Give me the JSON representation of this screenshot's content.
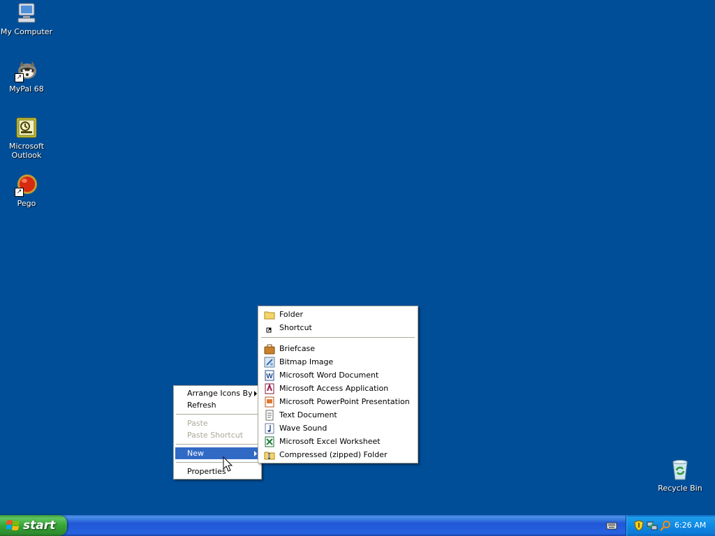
{
  "desktop": {
    "background": "#004e98",
    "icons": [
      {
        "label": "My Computer",
        "icon": "computer-icon"
      },
      {
        "label": "MyPal 68",
        "icon": "raccoon-icon"
      },
      {
        "label": "Microsoft Outlook",
        "icon": "outlook-icon"
      },
      {
        "label": "Pego",
        "icon": "pego-icon"
      },
      {
        "label": "Recycle Bin",
        "icon": "recycle-bin-icon"
      }
    ]
  },
  "context_menu": {
    "items": [
      {
        "label": "Arrange Icons By",
        "submenu": true,
        "enabled": true
      },
      {
        "label": "Refresh",
        "enabled": true
      },
      {
        "label": "Paste",
        "enabled": false
      },
      {
        "label": "Paste Shortcut",
        "enabled": false
      },
      {
        "label": "New",
        "submenu": true,
        "enabled": true,
        "selected": true
      },
      {
        "label": "Properties",
        "enabled": true
      }
    ],
    "highlight_color": "#316ac5"
  },
  "new_submenu": {
    "items": [
      {
        "label": "Folder",
        "icon": "folder-icon"
      },
      {
        "label": "Shortcut",
        "icon": "shortcut-icon"
      },
      {
        "label": "Briefcase",
        "icon": "briefcase-icon"
      },
      {
        "label": "Bitmap Image",
        "icon": "bitmap-icon"
      },
      {
        "label": "Microsoft Word Document",
        "icon": "word-icon"
      },
      {
        "label": "Microsoft Access Application",
        "icon": "access-icon"
      },
      {
        "label": "Microsoft PowerPoint Presentation",
        "icon": "powerpoint-icon"
      },
      {
        "label": "Text Document",
        "icon": "text-document-icon"
      },
      {
        "label": "Wave Sound",
        "icon": "wave-sound-icon"
      },
      {
        "label": "Microsoft Excel Worksheet",
        "icon": "excel-icon"
      },
      {
        "label": "Compressed (zipped) Folder",
        "icon": "zip-folder-icon"
      }
    ]
  },
  "taskbar": {
    "start_label": "start",
    "clock": "6:26 AM",
    "tray_icons": [
      "security-shield-icon",
      "network-icon",
      "search-icon"
    ]
  }
}
